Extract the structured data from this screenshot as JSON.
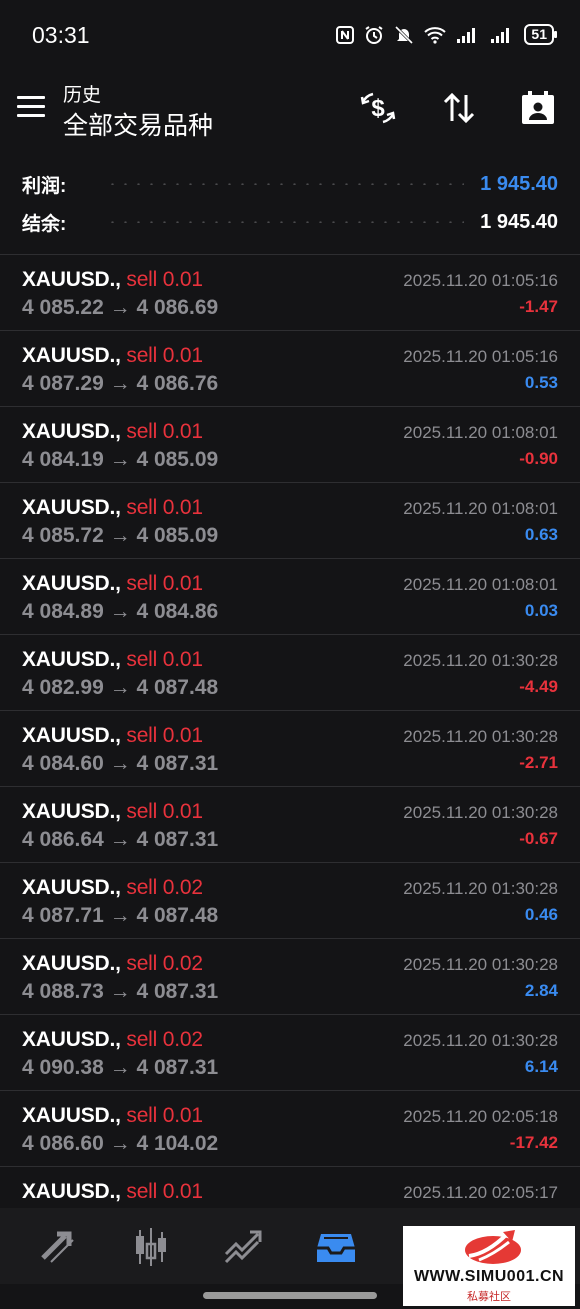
{
  "status_bar": {
    "time": "03:31",
    "battery": "51"
  },
  "header": {
    "title": "历史",
    "subtitle": "全部交易品种",
    "actions": [
      "dollar-exchange-icon",
      "sort-icon",
      "calendar-icon"
    ]
  },
  "summary": {
    "profit_label": "利润:",
    "profit_value": "1 945.40",
    "balance_label": "结余:",
    "balance_value": "1 945.40"
  },
  "colors": {
    "negative": "#e8323c",
    "positive": "#3a8bf0",
    "accent": "#3a8bf0"
  },
  "trades": [
    {
      "symbol": "XAUUSD.,",
      "type": "sell 0.01",
      "open": "4 085.22",
      "arrow": "→",
      "close": "4 086.69",
      "time": "2025.11.20 01:05:16",
      "profit": "-1.47"
    },
    {
      "symbol": "XAUUSD.,",
      "type": "sell 0.01",
      "open": "4 087.29",
      "arrow": "→",
      "close": "4 086.76",
      "time": "2025.11.20 01:05:16",
      "profit": "0.53"
    },
    {
      "symbol": "XAUUSD.,",
      "type": "sell 0.01",
      "open": "4 084.19",
      "arrow": "→",
      "close": "4 085.09",
      "time": "2025.11.20 01:08:01",
      "profit": "-0.90"
    },
    {
      "symbol": "XAUUSD.,",
      "type": "sell 0.01",
      "open": "4 085.72",
      "arrow": "→",
      "close": "4 085.09",
      "time": "2025.11.20 01:08:01",
      "profit": "0.63"
    },
    {
      "symbol": "XAUUSD.,",
      "type": "sell 0.01",
      "open": "4 084.89",
      "arrow": "→",
      "close": "4 084.86",
      "time": "2025.11.20 01:08:01",
      "profit": "0.03"
    },
    {
      "symbol": "XAUUSD.,",
      "type": "sell 0.01",
      "open": "4 082.99",
      "arrow": "→",
      "close": "4 087.48",
      "time": "2025.11.20 01:30:28",
      "profit": "-4.49"
    },
    {
      "symbol": "XAUUSD.,",
      "type": "sell 0.01",
      "open": "4 084.60",
      "arrow": "→",
      "close": "4 087.31",
      "time": "2025.11.20 01:30:28",
      "profit": "-2.71"
    },
    {
      "symbol": "XAUUSD.,",
      "type": "sell 0.01",
      "open": "4 086.64",
      "arrow": "→",
      "close": "4 087.31",
      "time": "2025.11.20 01:30:28",
      "profit": "-0.67"
    },
    {
      "symbol": "XAUUSD.,",
      "type": "sell 0.02",
      "open": "4 087.71",
      "arrow": "→",
      "close": "4 087.48",
      "time": "2025.11.20 01:30:28",
      "profit": "0.46"
    },
    {
      "symbol": "XAUUSD.,",
      "type": "sell 0.02",
      "open": "4 088.73",
      "arrow": "→",
      "close": "4 087.31",
      "time": "2025.11.20 01:30:28",
      "profit": "2.84"
    },
    {
      "symbol": "XAUUSD.,",
      "type": "sell 0.02",
      "open": "4 090.38",
      "arrow": "→",
      "close": "4 087.31",
      "time": "2025.11.20 01:30:28",
      "profit": "6.14"
    },
    {
      "symbol": "XAUUSD.,",
      "type": "sell 0.01",
      "open": "4 086.60",
      "arrow": "→",
      "close": "4 104.02",
      "time": "2025.11.20 02:05:18",
      "profit": "-17.42"
    },
    {
      "symbol": "XAUUSD.,",
      "type": "sell 0.01",
      "open": "",
      "arrow": "",
      "close": "",
      "time": "2025.11.20 02:05:17",
      "profit": ""
    }
  ],
  "bottom_nav": {
    "items": [
      "quotes-icon",
      "chart-icon",
      "trade-icon",
      "history-icon"
    ],
    "active": "history-icon"
  },
  "watermark": {
    "text": "WWW.SIMU001.CN",
    "sub": "私募社区"
  }
}
